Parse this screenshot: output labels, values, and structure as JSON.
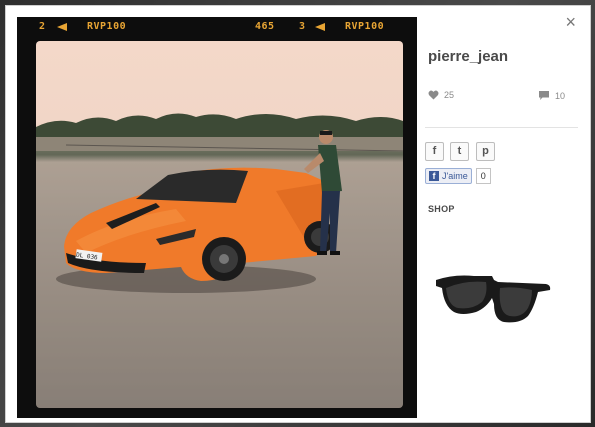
{
  "film": {
    "frame_a": "2",
    "label_a": "RVP100",
    "counter": "465",
    "frame_b": "3",
    "label_b": "RVP100"
  },
  "photo": {
    "plate_text": "DL 036"
  },
  "panel": {
    "close_label": "×",
    "username": "pierre_jean",
    "likes": "25",
    "comments": "10",
    "share": {
      "facebook": "f",
      "twitter": "t",
      "pinterest": "p"
    },
    "fb_like": {
      "label": "J'aime",
      "count": "0"
    },
    "shop_label": "SHOP"
  },
  "colors": {
    "film_accent": "#e8a534",
    "car": "#f07a2a",
    "fb_blue": "#3b5998"
  }
}
